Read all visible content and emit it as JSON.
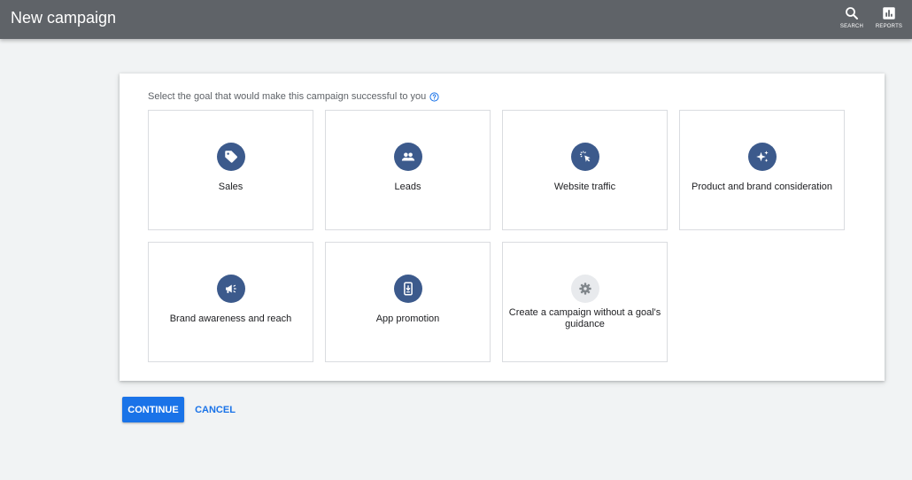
{
  "header": {
    "title": "New campaign",
    "search_label": "SEARCH",
    "search_icon": "search-icon",
    "reports_label": "REPORTS",
    "reports_icon": "bar-chart-icon"
  },
  "main": {
    "prompt": "Select the goal that would make this campaign successful to you",
    "help_icon": "help-circle-icon",
    "goals": [
      {
        "label": "Sales",
        "icon": "tag-icon"
      },
      {
        "label": "Leads",
        "icon": "people-icon"
      },
      {
        "label": "Website traffic",
        "icon": "cursor-click-icon"
      },
      {
        "label": "Product and brand consideration",
        "icon": "sparkle-icon"
      },
      {
        "label": "Brand awareness and reach",
        "icon": "megaphone-icon"
      },
      {
        "label": "App promotion",
        "icon": "phone-download-icon"
      },
      {
        "label": "Create a campaign without a goal's guidance",
        "icon": "gear-icon"
      }
    ]
  },
  "actions": {
    "continue_label": "CONTINUE",
    "cancel_label": "CANCEL"
  },
  "colors": {
    "header_bg": "#5f6368",
    "accent": "#1a73e8",
    "icon_bg": "#3c5a8c",
    "page_bg": "#f1f3f4"
  }
}
